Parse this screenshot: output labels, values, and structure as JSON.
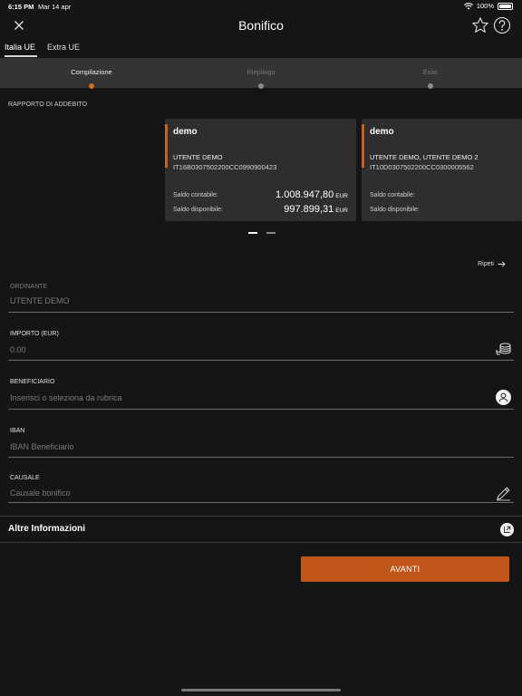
{
  "status": {
    "time": "6:15 PM",
    "date": "Mar 14 apr",
    "battery": "100%"
  },
  "header": {
    "title": "Bonifico",
    "icons": {
      "close": "close-icon",
      "favorite": "star-icon",
      "help": "help-icon"
    }
  },
  "tabs": [
    {
      "label": "Italia UE",
      "active": true
    },
    {
      "label": "Extra UE",
      "active": false
    }
  ],
  "stepper": [
    {
      "label": "Compilazione",
      "active": true
    },
    {
      "label": "Riepilogo",
      "active": false
    },
    {
      "label": "Esito",
      "active": false
    }
  ],
  "account_section": {
    "label": "RAPPORTO DI ADDEBITO",
    "cards": [
      {
        "name": "demo",
        "holder": "UTENTE DEMO",
        "iban": "IT16B0307502200CC0990900423",
        "saldo_contabile_label": "Saldo contabile:",
        "saldo_contabile": "1.008.947,80",
        "saldo_disponibile_label": "Saldo disponibile:",
        "saldo_disponibile": "997.899,31",
        "currency": "EUR"
      },
      {
        "name": "demo",
        "holder": "UTENTE DEMO, UTENTE DEMO 2",
        "iban": "IT10D0307502200CC0300005562",
        "saldo_contabile_label": "Saldo contabile:",
        "saldo_disponibile_label": "Saldo disponibile:"
      }
    ],
    "pager": {
      "pages": 2,
      "current": 1
    }
  },
  "ripeti": {
    "label": "Ripeti"
  },
  "fields": {
    "ordinante": {
      "label": "ORDINANTE",
      "value": "UTENTE DEMO"
    },
    "importo": {
      "label": "IMPORTO (EUR)",
      "placeholder": "0.00",
      "icon": "coins-icon"
    },
    "beneficiario": {
      "label": "BENEFICIARIO",
      "placeholder": "Inserisci o seleziona da rubrica",
      "icon": "contact-icon"
    },
    "iban": {
      "label": "IBAN",
      "placeholder": "IBAN Beneficiario"
    },
    "causale": {
      "label": "CAUSALE",
      "placeholder": "Causale bonifico",
      "icon": "pencil-icon"
    }
  },
  "altre": {
    "label": "Altre Informazioni",
    "icon": "expand-icon"
  },
  "submit": {
    "label": "AVANTI"
  },
  "colors": {
    "accent": "#c0561a",
    "background": "#151515",
    "stepper_bg": "#343434",
    "card_bg": "#2e2e2e"
  }
}
